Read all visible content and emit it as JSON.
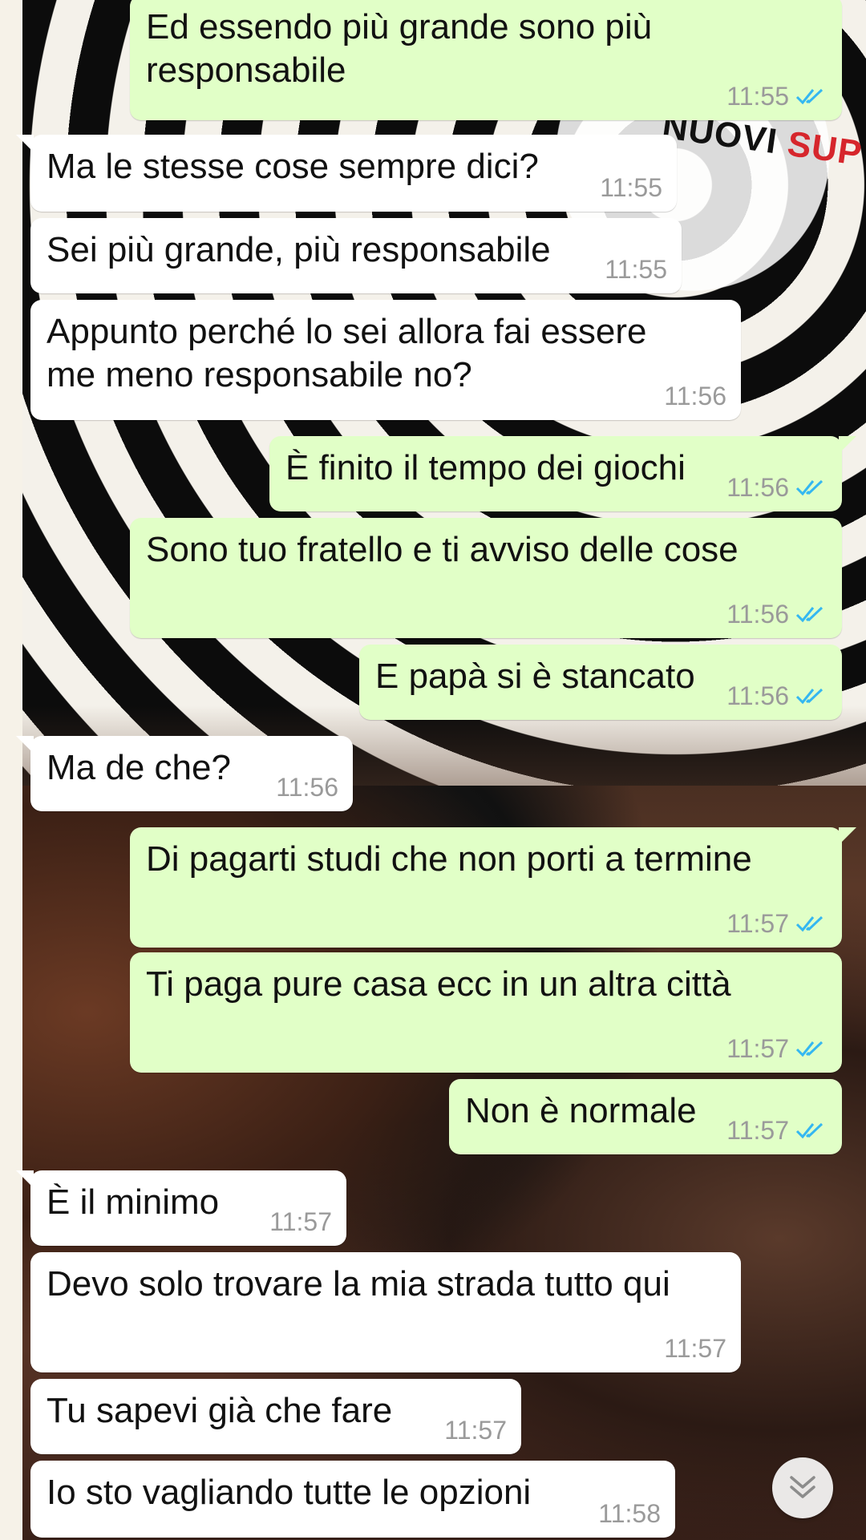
{
  "wallpaper": {
    "poster_text_dark": "NUOVI ",
    "poster_text_red": "SUP"
  },
  "colors": {
    "incoming_bubble": "#ffffff",
    "outgoing_bubble": "#e1ffc7",
    "timestamp": "#9a9a9a",
    "read_ticks": "#34b7f1"
  },
  "messages": [
    {
      "direction": "out",
      "text": "Ed essendo più grande sono più\nresponsabile",
      "time": "11:55",
      "status": "read-ticks-icon"
    },
    {
      "direction": "in",
      "text": "Ma le stesse cose sempre dici?",
      "time": "11:55"
    },
    {
      "direction": "in",
      "text": "Sei più grande, più responsabile",
      "time": "11:55"
    },
    {
      "direction": "in",
      "text": "Appunto perché lo sei allora fai essere\nme meno responsabile no?",
      "time": "11:56"
    },
    {
      "direction": "out",
      "text": "È finito il tempo dei giochi",
      "time": "11:56",
      "status": "read-ticks-icon"
    },
    {
      "direction": "out",
      "text": "Sono tuo fratello e ti avviso delle cose",
      "time": "11:56",
      "status": "read-ticks-icon"
    },
    {
      "direction": "out",
      "text": "E papà si è stancato",
      "time": "11:56",
      "status": "read-ticks-icon"
    },
    {
      "direction": "in",
      "text": "Ma de che?",
      "time": "11:56"
    },
    {
      "direction": "out",
      "text": "Di pagarti studi che non porti a termine",
      "time": "11:57",
      "status": "read-ticks-icon"
    },
    {
      "direction": "out",
      "text": "Ti paga pure casa ecc in un altra città",
      "time": "11:57",
      "status": "read-ticks-icon"
    },
    {
      "direction": "out",
      "text": "Non è normale",
      "time": "11:57",
      "status": "read-ticks-icon"
    },
    {
      "direction": "in",
      "text": "È il minimo",
      "time": "11:57"
    },
    {
      "direction": "in",
      "text": "Devo solo trovare la mia strada tutto qui",
      "time": "11:57"
    },
    {
      "direction": "in",
      "text": "Tu sapevi già che fare",
      "time": "11:57"
    },
    {
      "direction": "in",
      "text": "Io sto vagliando tutte le opzioni",
      "time": "11:58"
    }
  ],
  "scroll_button": {
    "icon": "double-chevron-down-icon"
  }
}
